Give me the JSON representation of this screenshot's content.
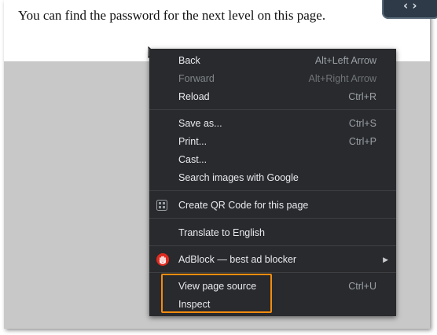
{
  "page": {
    "text": "You can find the password for the next level on this page."
  },
  "context_menu": {
    "items": [
      {
        "label": "Back",
        "shortcut": "Alt+Left Arrow",
        "enabled": true
      },
      {
        "label": "Forward",
        "shortcut": "Alt+Right Arrow",
        "enabled": false
      },
      {
        "label": "Reload",
        "shortcut": "Ctrl+R",
        "enabled": true
      },
      {
        "label": "Save as...",
        "shortcut": "Ctrl+S",
        "enabled": true
      },
      {
        "label": "Print...",
        "shortcut": "Ctrl+P",
        "enabled": true
      },
      {
        "label": "Cast...",
        "shortcut": "",
        "enabled": true
      },
      {
        "label": "Search images with Google",
        "shortcut": "",
        "enabled": true
      },
      {
        "label": "Create QR Code for this page",
        "shortcut": "",
        "enabled": true,
        "icon": "qr-code-icon"
      },
      {
        "label": "Translate to English",
        "shortcut": "",
        "enabled": true
      },
      {
        "label": "AdBlock — best ad blocker",
        "shortcut": "",
        "enabled": true,
        "icon": "adblock-hand-icon",
        "submenu": true
      },
      {
        "label": "View page source",
        "shortcut": "Ctrl+U",
        "enabled": true
      },
      {
        "label": "Inspect",
        "shortcut": "",
        "enabled": true
      }
    ]
  },
  "colors": {
    "menu_background": "#292a2d",
    "menu_text": "#e8eaed",
    "highlight_border": "#f28c0f",
    "adblock_red": "#e02b20"
  }
}
